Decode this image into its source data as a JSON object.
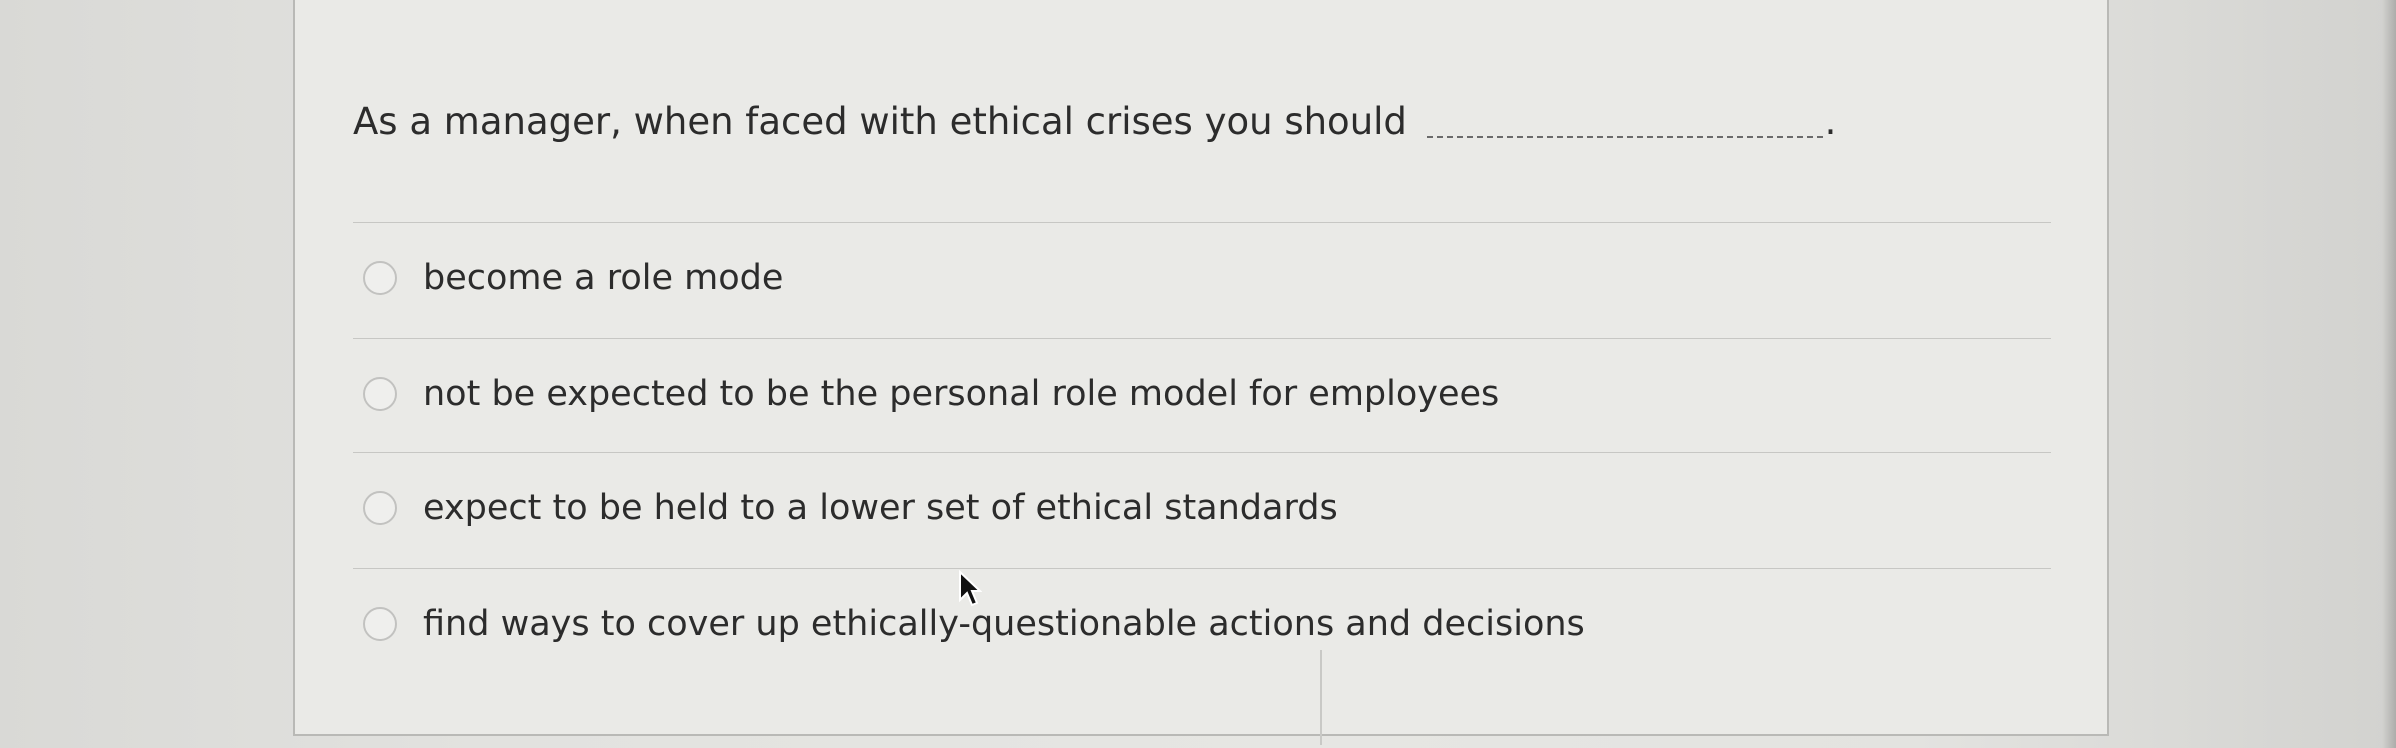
{
  "question": {
    "text": "As a manager, when faced with ethical crises you should",
    "punctuation": "."
  },
  "options": [
    {
      "label": "become a role mode"
    },
    {
      "label": "not be expected to be the personal role model for employees"
    },
    {
      "label": "expect to be held to a lower set of ethical standards"
    },
    {
      "label": "find ways to cover up ethically-questionable actions and decisions"
    }
  ],
  "icons": {
    "radio": "radio-button-icon",
    "cursor": "mouse-pointer-icon"
  },
  "colors": {
    "text": "#2c2c2c",
    "card": "#eaeae7",
    "border": "#b9b9b6"
  }
}
